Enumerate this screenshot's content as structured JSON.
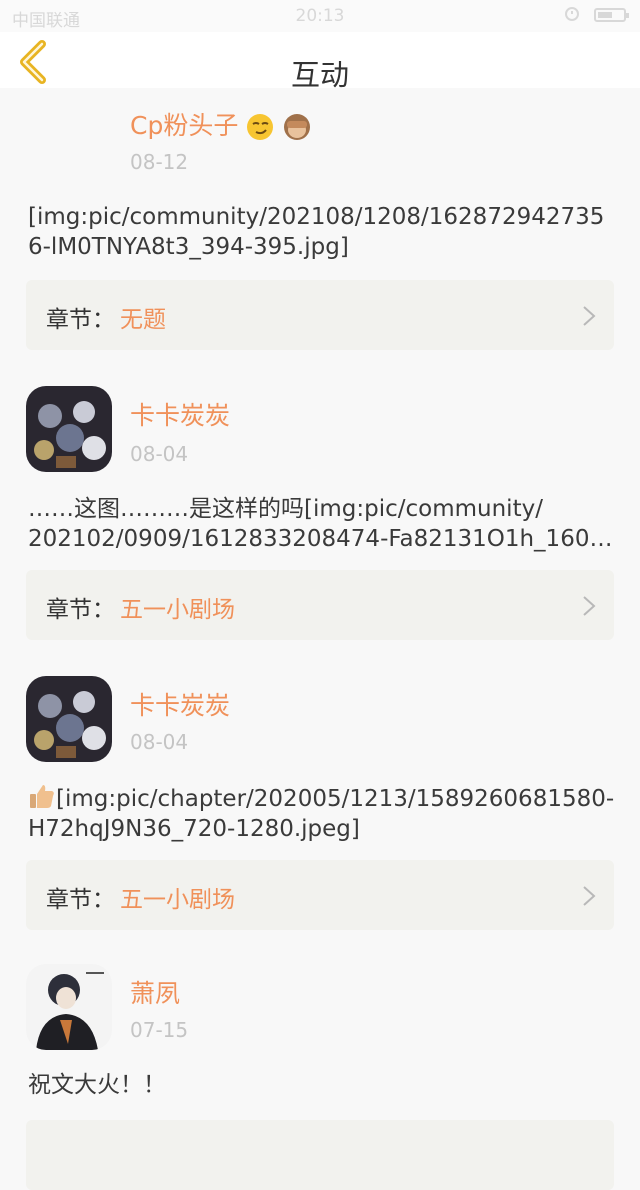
{
  "status_bar": {
    "carrier": "中国联通",
    "time": "20:13"
  },
  "header": {
    "title": "互动"
  },
  "colors": {
    "accent": "#f0915a",
    "card_bg": "#f2f2ee"
  },
  "posts": [
    {
      "username": "Cp粉头子",
      "date": "08-12",
      "content": "[img:pic/community/202108/1208/1628729427356-lM0TNYA8t3_394-395.jpg]",
      "chapter_label": "章节：",
      "chapter_name": "无题"
    },
    {
      "username": "卡卡炭炭",
      "date": "08-04",
      "content_line1": "……这图………是这样的吗[img:pic/community/",
      "content_line2": "202102/0909/1612833208474-Fa82131O1h_160…",
      "chapter_label": "章节：",
      "chapter_name": "五一小剧场"
    },
    {
      "username": "卡卡炭炭",
      "date": "08-04",
      "content": "[img:pic/chapter/202005/1213/1589260681580-H72hqJ9N36_720-1280.jpeg]",
      "chapter_label": "章节：",
      "chapter_name": "五一小剧场"
    },
    {
      "username": "萧夙",
      "date": "07-15",
      "content": "祝文大火！！"
    }
  ]
}
